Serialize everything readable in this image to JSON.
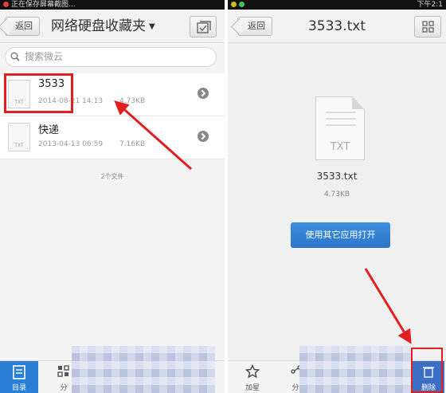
{
  "left": {
    "statusbar_text": "正在保存屏幕截图...",
    "back_label": "返回",
    "title": "网络硬盘收藏夹",
    "search_placeholder": "搜索微云",
    "files": [
      {
        "name": "3533",
        "date": "2014-08-21 14:13",
        "size": "4.73KB",
        "type": "TXT"
      },
      {
        "name": "快递",
        "date": "2013-04-13 06:59",
        "size": "7.16KB",
        "type": "TXT"
      }
    ],
    "file_count": "2个文件",
    "tabs": [
      {
        "label": "目录",
        "icon": "document-icon",
        "active": true
      },
      {
        "label": "分",
        "icon": "grid-icon",
        "active": false
      }
    ]
  },
  "right": {
    "statusbar_time": "下午2:1",
    "back_label": "返回",
    "title": "3533.txt",
    "doc_type": "TXT",
    "file_name": "3533.txt",
    "file_size": "4.73KB",
    "open_button": "使用其它应用打开",
    "tabs": [
      {
        "label": "加星",
        "icon": "star-icon"
      },
      {
        "label": "分",
        "icon": "share-icon"
      },
      {
        "label": "删除",
        "icon": "delete-icon"
      }
    ]
  },
  "colors": {
    "accent": "#2a7fd4",
    "annotation": "#e02020"
  }
}
